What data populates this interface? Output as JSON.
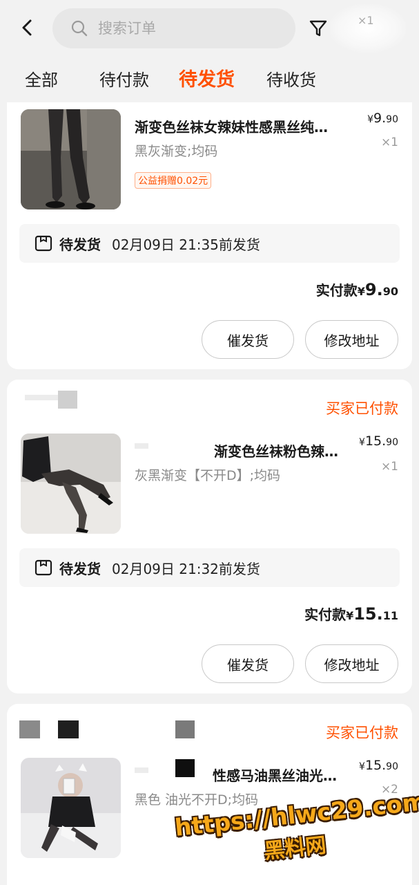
{
  "header": {
    "search_placeholder": "搜索订单",
    "filter_count": "×1"
  },
  "tabs": [
    {
      "label": "全部"
    },
    {
      "label": "待付款"
    },
    {
      "label": "待发货",
      "active": true
    },
    {
      "label": "待收货"
    }
  ],
  "orders": [
    {
      "title": "渐变色丝袜女辣妹性感黑丝纯…",
      "sku": "黑灰渐变;均码",
      "price_int": "9.",
      "price_cents": "90",
      "qty": "×1",
      "donation": "公益捐赠0.02元",
      "ship_status": "待发货",
      "ship_time": "02月09日 21:35前发货",
      "paid_label": "实付款",
      "paid_int": "9.",
      "paid_cents": "90",
      "buttons": [
        "催发货",
        "修改地址"
      ]
    },
    {
      "store_status": "买家已付款",
      "title": "渐变色丝袜粉色辣…",
      "sku": "灰黑渐变【不开D】;均码",
      "price_int": "15.",
      "price_cents": "90",
      "qty": "×1",
      "ship_status": "待发货",
      "ship_time": "02月09日 21:32前发货",
      "paid_label": "实付款",
      "paid_int": "15.",
      "paid_cents": "11",
      "buttons": [
        "催发货",
        "修改地址"
      ]
    },
    {
      "store_status": "买家已付款",
      "title": "性感马油黑丝油光…",
      "sku": "黑色 油光不开D;均码",
      "price_int": "15.",
      "price_cents": "90",
      "qty": "×2"
    }
  ],
  "currency": "¥",
  "watermark": {
    "url": "https://hlwc29.com",
    "site": "黑料网"
  },
  "colors": {
    "accent": "#ff5000",
    "background": "#f2f2f2",
    "card": "#ffffff"
  }
}
